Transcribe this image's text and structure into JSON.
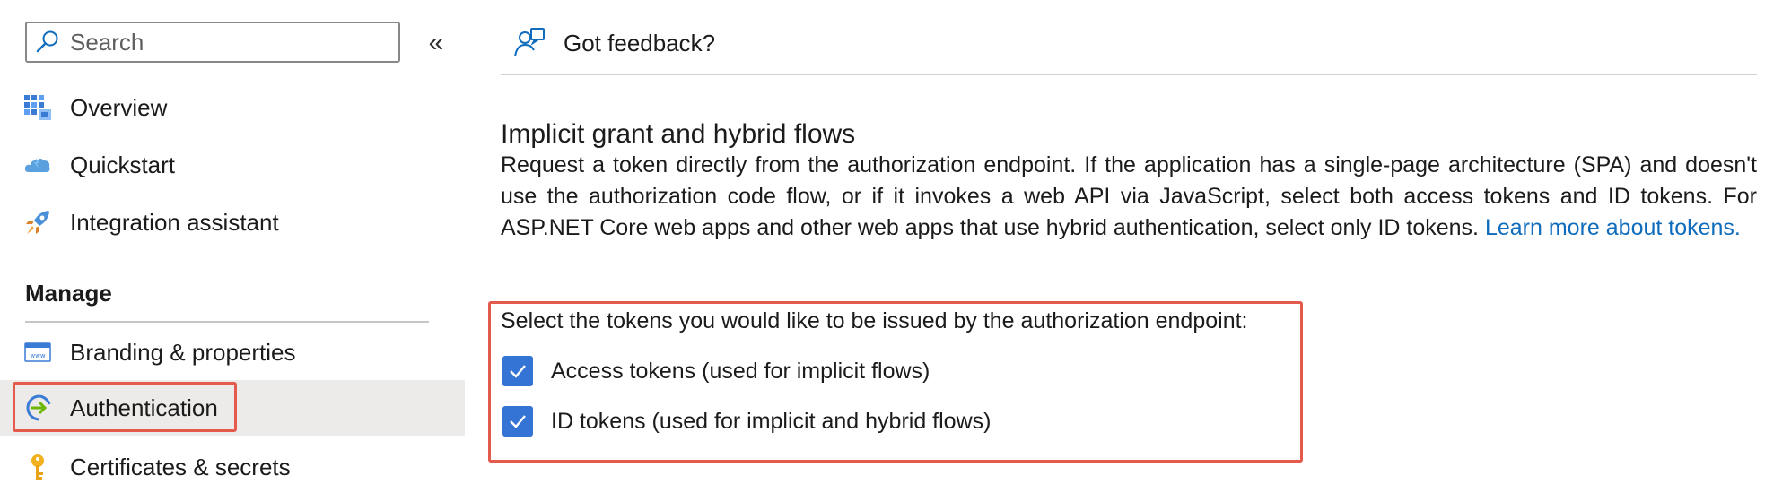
{
  "sidebar": {
    "search": {
      "placeholder": "Search",
      "value": ""
    },
    "collapse_glyph": "«",
    "items": [
      {
        "label": "Overview",
        "icon": "overview-grid-icon"
      },
      {
        "label": "Quickstart",
        "icon": "quickstart-cloud-icon"
      },
      {
        "label": "Integration assistant",
        "icon": "rocket-icon"
      }
    ],
    "manage_header": "Manage",
    "manage_items": [
      {
        "label": "Branding & properties",
        "icon": "branding-www-icon"
      },
      {
        "label": "Authentication",
        "icon": "authentication-icon",
        "active": true
      },
      {
        "label": "Certificates & secrets",
        "icon": "key-icon"
      }
    ]
  },
  "main": {
    "feedback_label": "Got feedback?",
    "section_title": "Implicit grant and hybrid flows",
    "description": "Request a token directly from the authorization endpoint. If the application has a single-page architecture (SPA) and doesn't use the authorization code flow, or if it invokes a web API via JavaScript, select both access tokens and ID tokens. For ASP.NET Core web apps and other web apps that use hybrid authentication, select only ID tokens.",
    "learn_more_link": "Learn more about tokens.",
    "token_prompt": "Select the tokens you would like to be issued by the authorization endpoint:",
    "tokens": [
      {
        "label": "Access tokens (used for implicit flows)",
        "checked": true
      },
      {
        "label": "ID tokens (used for implicit and hybrid flows)",
        "checked": true
      }
    ]
  },
  "colors": {
    "accent": "#0f6cbd",
    "checkbox": "#3474d4",
    "highlight_outline": "#e45a4c",
    "active_bg": "#edebe9"
  }
}
